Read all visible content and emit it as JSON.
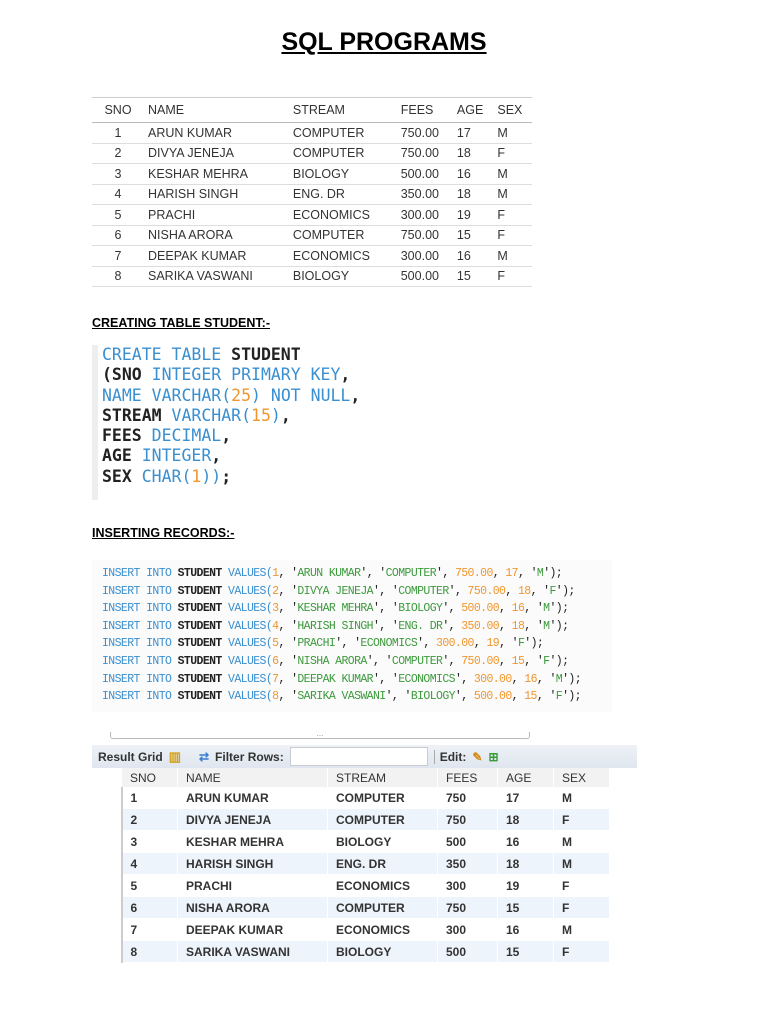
{
  "title": "SQL PROGRAMS",
  "table1": {
    "headers": [
      "SNO",
      "NAME",
      "STREAM",
      "FEES",
      "AGE",
      "SEX"
    ],
    "rows": [
      [
        "1",
        "ARUN KUMAR",
        "COMPUTER",
        "750.00",
        "17",
        "M"
      ],
      [
        "2",
        "DIVYA JENEJA",
        "COMPUTER",
        "750.00",
        "18",
        "F"
      ],
      [
        "3",
        "KESHAR MEHRA",
        "BIOLOGY",
        "500.00",
        "16",
        "M"
      ],
      [
        "4",
        "HARISH SINGH",
        "ENG. DR",
        "350.00",
        "18",
        "M"
      ],
      [
        "5",
        "PRACHI",
        "ECONOMICS",
        "300.00",
        "19",
        "F"
      ],
      [
        "6",
        "NISHA ARORA",
        "COMPUTER",
        "750.00",
        "15",
        "F"
      ],
      [
        "7",
        "DEEPAK KUMAR",
        "ECONOMICS",
        "300.00",
        "16",
        "M"
      ],
      [
        "8",
        "SARIKA VASWANI",
        "BIOLOGY",
        "500.00",
        "15",
        "F"
      ]
    ]
  },
  "heading_create": "CREATING TABLE STUDENT:-",
  "create_code": [
    [
      [
        "CREATE TABLE ",
        "kw"
      ],
      [
        "STUDENT",
        "id"
      ]
    ],
    [
      [
        "(SNO ",
        "id"
      ],
      [
        "INTEGER PRIMARY KEY",
        "kw"
      ],
      [
        ",",
        "pu"
      ]
    ],
    [
      [
        "NAME ",
        "kw"
      ],
      [
        "VARCHAR(",
        "kw"
      ],
      [
        "25",
        "num"
      ],
      [
        ") NOT NULL",
        "kw"
      ],
      [
        ",",
        "pu"
      ]
    ],
    [
      [
        "STREAM ",
        "id"
      ],
      [
        "VARCHAR(",
        "kw"
      ],
      [
        "15",
        "num"
      ],
      [
        ")",
        "kw"
      ],
      [
        ",",
        "pu"
      ]
    ],
    [
      [
        "FEES ",
        "id"
      ],
      [
        "DECIMAL",
        "kw"
      ],
      [
        ",",
        "pu"
      ]
    ],
    [
      [
        "AGE ",
        "id"
      ],
      [
        "INTEGER",
        "kw"
      ],
      [
        ",",
        "pu"
      ]
    ],
    [
      [
        "SEX ",
        "id"
      ],
      [
        "CHAR(",
        "kw"
      ],
      [
        "1",
        "num"
      ],
      [
        "))",
        "kw"
      ],
      [
        ";",
        "pu"
      ]
    ]
  ],
  "heading_insert": "INSERTING RECORDS:-",
  "insert_rows": [
    [
      "1",
      "ARUN KUMAR",
      "COMPUTER",
      "750.00",
      "17",
      "M"
    ],
    [
      "2",
      "DIVYA JENEJA",
      "COMPUTER",
      "750.00",
      "18",
      "F"
    ],
    [
      "3",
      "KESHAR MEHRA",
      "BIOLOGY",
      "500.00",
      "16",
      "M"
    ],
    [
      "4",
      "HARISH SINGH",
      "ENG. DR",
      "350.00",
      "18",
      "M"
    ],
    [
      "5",
      "PRACHI",
      "ECONOMICS",
      "300.00",
      "19",
      "F"
    ],
    [
      "6",
      "NISHA ARORA",
      "COMPUTER",
      "750.00",
      "15",
      "F"
    ],
    [
      "7",
      "DEEPAK KUMAR",
      "ECONOMICS",
      "300.00",
      "16",
      "M"
    ],
    [
      "8",
      "SARIKA VASWANI",
      "BIOLOGY",
      "500.00",
      "15",
      "F"
    ]
  ],
  "insert_prefix": {
    "kw1": "INSERT INTO ",
    "tbl": "STUDENT",
    "kw2": " VALUES("
  },
  "result_grid": {
    "label": "Result Grid",
    "filter_label": "Filter Rows:",
    "filter_value": "",
    "edit_label": "Edit:",
    "scroll_dots": "...",
    "headers": [
      "SNO",
      "NAME",
      "STREAM",
      "FEES",
      "AGE",
      "SEX"
    ],
    "rows": [
      [
        "1",
        "ARUN KUMAR",
        "COMPUTER",
        "750",
        "17",
        "M"
      ],
      [
        "2",
        "DIVYA JENEJA",
        "COMPUTER",
        "750",
        "18",
        "F"
      ],
      [
        "3",
        "KESHAR MEHRA",
        "BIOLOGY",
        "500",
        "16",
        "M"
      ],
      [
        "4",
        "HARISH SINGH",
        "ENG. DR",
        "350",
        "18",
        "M"
      ],
      [
        "5",
        "PRACHI",
        "ECONOMICS",
        "300",
        "19",
        "F"
      ],
      [
        "6",
        "NISHA ARORA",
        "COMPUTER",
        "750",
        "15",
        "F"
      ],
      [
        "7",
        "DEEPAK KUMAR",
        "ECONOMICS",
        "300",
        "16",
        "M"
      ],
      [
        "8",
        "SARIKA VASWANI",
        "BIOLOGY",
        "500",
        "15",
        "F"
      ]
    ]
  }
}
